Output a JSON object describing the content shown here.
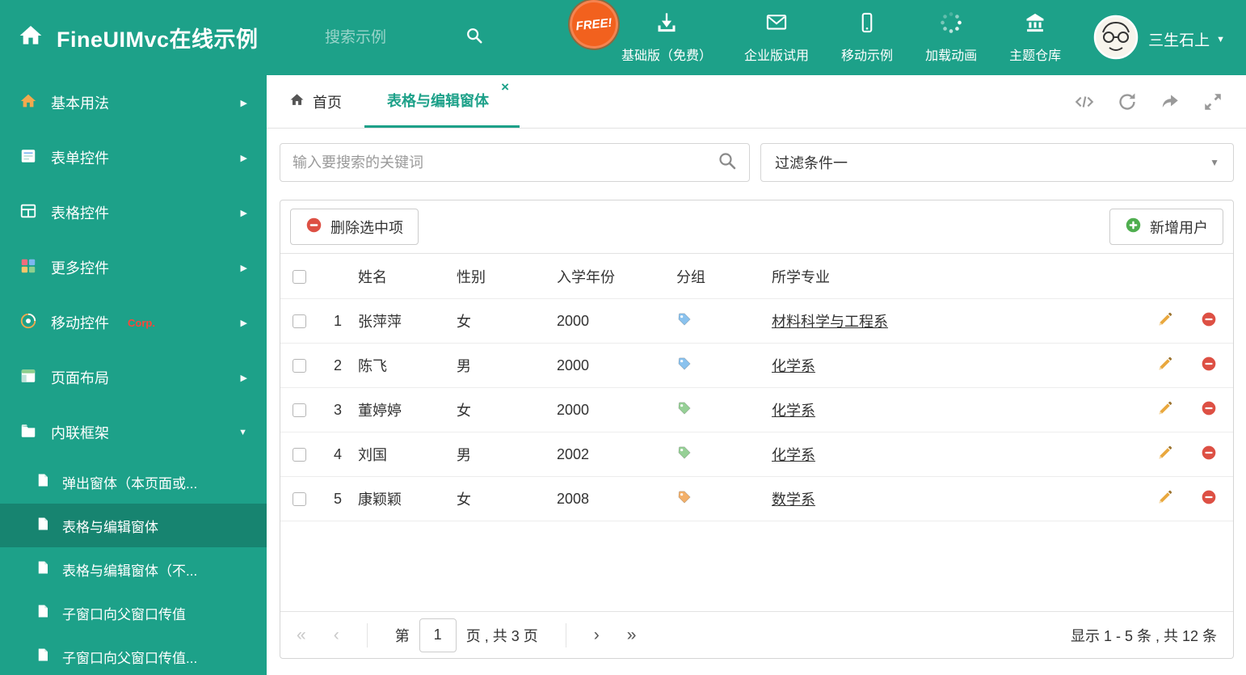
{
  "header": {
    "title": "FineUIMvc在线示例",
    "search_placeholder": "搜索示例",
    "free_badge": "FREE!",
    "nav": [
      {
        "label": "基础版（免费）",
        "icon": "download-icon"
      },
      {
        "label": "企业版试用",
        "icon": "envelope-icon"
      },
      {
        "label": "移动示例",
        "icon": "mobile-icon"
      },
      {
        "label": "加载动画",
        "icon": "spinner-icon"
      },
      {
        "label": "主题仓库",
        "icon": "museum-icon"
      }
    ],
    "user_name": "三生石上"
  },
  "sidebar": {
    "items": [
      {
        "label": "基本用法"
      },
      {
        "label": "表单控件"
      },
      {
        "label": "表格控件"
      },
      {
        "label": "更多控件"
      },
      {
        "label": "移动控件",
        "badge": "Corp."
      },
      {
        "label": "页面布局"
      },
      {
        "label": "内联框架"
      }
    ],
    "subitems": [
      {
        "label": "弹出窗体（本页面或..."
      },
      {
        "label": "表格与编辑窗体"
      },
      {
        "label": "表格与编辑窗体（不..."
      },
      {
        "label": "子窗口向父窗口传值"
      },
      {
        "label": "子窗口向父窗口传值..."
      }
    ]
  },
  "tabs": {
    "home": "首页",
    "active": "表格与编辑窗体"
  },
  "content": {
    "search_placeholder": "输入要搜索的关键词",
    "filter_value": "过滤条件一",
    "toolbar": {
      "delete_label": "删除选中项",
      "add_label": "新增用户"
    },
    "table": {
      "headers": {
        "name": "姓名",
        "gender": "性别",
        "year": "入学年份",
        "group": "分组",
        "major": "所学专业"
      },
      "rows": [
        {
          "num": "1",
          "name": "张萍萍",
          "gender": "女",
          "year": "2000",
          "tag_color": "#8ac2ee",
          "major": "材料科学与工程系"
        },
        {
          "num": "2",
          "name": "陈飞",
          "gender": "男",
          "year": "2000",
          "tag_color": "#8ac2ee",
          "major": "化学系"
        },
        {
          "num": "3",
          "name": "董婷婷",
          "gender": "女",
          "year": "2000",
          "tag_color": "#96d096",
          "major": "化学系"
        },
        {
          "num": "4",
          "name": "刘国",
          "gender": "男",
          "year": "2002",
          "tag_color": "#96d096",
          "major": "化学系"
        },
        {
          "num": "5",
          "name": "康颖颖",
          "gender": "女",
          "year": "2008",
          "tag_color": "#f3b06a",
          "major": "数学系"
        }
      ]
    },
    "pagination": {
      "prefix": "第",
      "page": "1",
      "suffix": "页 , 共 3 页",
      "summary": "显示 1 - 5 条 , 共 12 条"
    }
  },
  "icons": {
    "chevron_right": "▶",
    "chevron_down": "▼",
    "caret_down": "▼",
    "close": "×",
    "first_page": "«",
    "prev_page": "‹",
    "next_page": "›",
    "last_page": "»"
  },
  "colors": {
    "theme": "#1da189",
    "free_badge": "#f2611e",
    "delete_red": "#dd5044",
    "add_green": "#4fae4f",
    "pencil_orange": "#e9a83e"
  }
}
